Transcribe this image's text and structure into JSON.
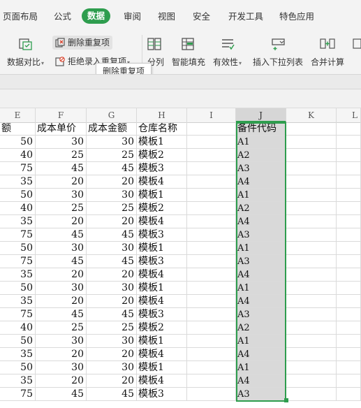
{
  "ribbon": {
    "tabs": [
      {
        "label": "页面布局"
      },
      {
        "label": "公式"
      },
      {
        "label": "数据",
        "active": true
      },
      {
        "label": "审阅"
      },
      {
        "label": "视图"
      },
      {
        "label": "安全"
      },
      {
        "label": "开发工具"
      },
      {
        "label": "特色应用"
      }
    ]
  },
  "toolbar": {
    "data_compare": "数据对比",
    "remove_duplicates": "删除重复项",
    "reject_duplicates": "拒绝录入重复项",
    "split_columns": "分列",
    "smart_fill": "智能填充",
    "validity": "有效性",
    "insert_dropdown": "插入下拉列表",
    "merge_calc": "合并计算",
    "tooltip": "删除重复项"
  },
  "columns": [
    "E",
    "F",
    "G",
    "H",
    "I",
    "J",
    "K",
    "L"
  ],
  "headers": {
    "E": "额",
    "F": "成本单价",
    "G": "成本金额",
    "H": "仓库名称",
    "J": "备件代码"
  },
  "rows": [
    {
      "e": "50",
      "f": "30",
      "g": "30",
      "h": "模板1",
      "j": "A1"
    },
    {
      "e": "40",
      "f": "25",
      "g": "25",
      "h": "模板2",
      "j": "A2"
    },
    {
      "e": "75",
      "f": "45",
      "g": "45",
      "h": "模板3",
      "j": "A3"
    },
    {
      "e": "35",
      "f": "20",
      "g": "20",
      "h": "模板4",
      "j": "A4"
    },
    {
      "e": "50",
      "f": "30",
      "g": "30",
      "h": "模板1",
      "j": "A1"
    },
    {
      "e": "40",
      "f": "25",
      "g": "25",
      "h": "模板2",
      "j": "A2"
    },
    {
      "e": "35",
      "f": "20",
      "g": "20",
      "h": "模板4",
      "j": "A4"
    },
    {
      "e": "75",
      "f": "45",
      "g": "45",
      "h": "模板3",
      "j": "A3"
    },
    {
      "e": "50",
      "f": "30",
      "g": "30",
      "h": "模板1",
      "j": "A1"
    },
    {
      "e": "75",
      "f": "45",
      "g": "45",
      "h": "模板3",
      "j": "A3"
    },
    {
      "e": "35",
      "f": "20",
      "g": "20",
      "h": "模板4",
      "j": "A4"
    },
    {
      "e": "50",
      "f": "30",
      "g": "30",
      "h": "模板1",
      "j": "A1"
    },
    {
      "e": "35",
      "f": "20",
      "g": "20",
      "h": "模板4",
      "j": "A4"
    },
    {
      "e": "75",
      "f": "45",
      "g": "45",
      "h": "模板3",
      "j": "A3"
    },
    {
      "e": "40",
      "f": "25",
      "g": "25",
      "h": "模板2",
      "j": "A2"
    },
    {
      "e": "50",
      "f": "30",
      "g": "30",
      "h": "模板1",
      "j": "A1"
    },
    {
      "e": "35",
      "f": "20",
      "g": "20",
      "h": "模板4",
      "j": "A4"
    },
    {
      "e": "50",
      "f": "30",
      "g": "30",
      "h": "模板1",
      "j": "A1"
    },
    {
      "e": "35",
      "f": "20",
      "g": "20",
      "h": "模板4",
      "j": "A4"
    },
    {
      "e": "75",
      "f": "45",
      "g": "45",
      "h": "模板3",
      "j": "A3"
    }
  ],
  "colors": {
    "accent": "#2e9d4e",
    "selection_fill": "#d9d9d9"
  }
}
